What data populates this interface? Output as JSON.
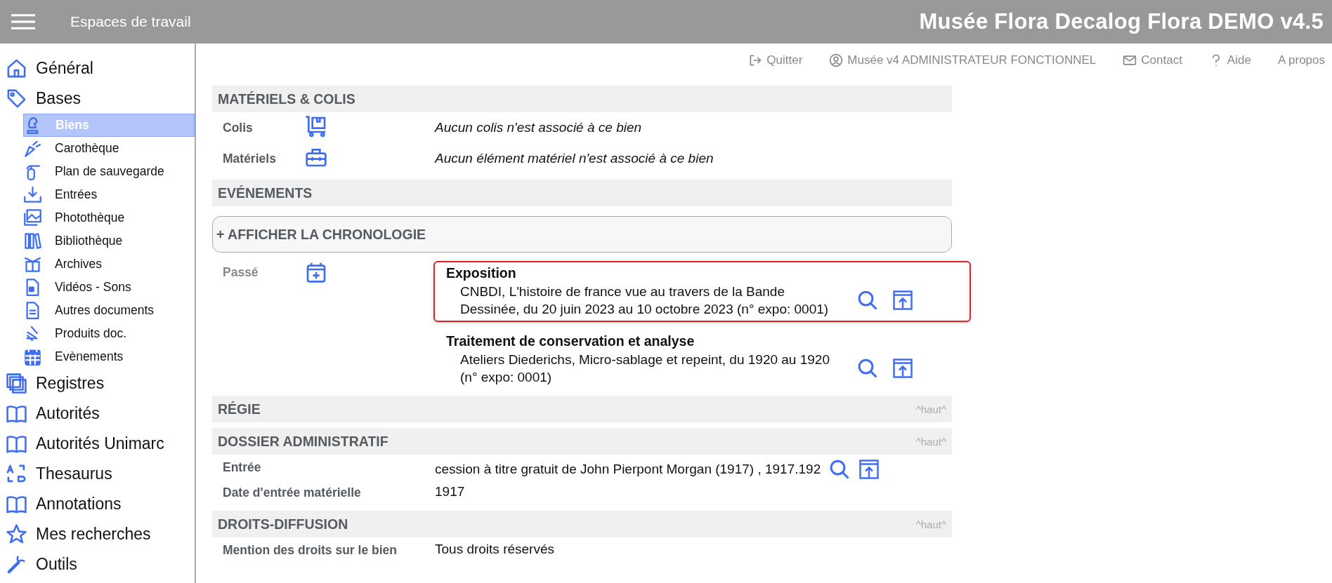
{
  "header": {
    "workspaces": "Espaces de travail",
    "app_title": "Musée Flora Decalog Flora DEMO v4.5"
  },
  "toolbar": [
    {
      "label": "Quitter"
    },
    {
      "label": "Musée v4 ADMINISTRATEUR FONCTIONNEL"
    },
    {
      "label": "Contact"
    },
    {
      "label": "Aide"
    },
    {
      "label": "A propos"
    }
  ],
  "sidebar": {
    "items": [
      {
        "label": "Général"
      },
      {
        "label": "Bases",
        "children": [
          {
            "label": "Biens",
            "selected": true
          },
          {
            "label": "Carothèque",
            "selected": false
          },
          {
            "label": "Plan de sauvegarde",
            "selected": false
          },
          {
            "label": "Entrées",
            "selected": false
          },
          {
            "label": "Photothèque",
            "selected": false
          },
          {
            "label": "Bibliothèque",
            "selected": false
          },
          {
            "label": "Archives",
            "selected": false
          },
          {
            "label": "Vidéos - Sons",
            "selected": false
          },
          {
            "label": "Autres documents",
            "selected": false
          },
          {
            "label": "Produits doc.",
            "selected": false
          },
          {
            "label": "Evènements",
            "selected": false
          }
        ]
      },
      {
        "label": "Registres"
      },
      {
        "label": "Autorités"
      },
      {
        "label": "Autorités Unimarc"
      },
      {
        "label": "Thesaurus"
      },
      {
        "label": "Annotations"
      },
      {
        "label": "Mes recherches"
      },
      {
        "label": "Outils"
      }
    ]
  },
  "sections": [
    {
      "title": "MATÉRIELS & COLIS",
      "rows": [
        {
          "kind": "note",
          "label": "Colis",
          "value": "Aucun colis n'est associé à ce bien"
        },
        {
          "kind": "note",
          "label": "Matériels",
          "value": "Aucun élément matériel n'est associé à ce bien"
        }
      ]
    },
    {
      "title": "EVÉNEMENTS",
      "toggle": "+ AFFICHER LA CHRONOLOGIE",
      "events": {
        "label": "Passé",
        "items": [
          {
            "title": "Exposition",
            "text": "CNBDI, L'histoire de france vue au travers de la Bande Dessinée, du 20 juin 2023 au 10 octobre 2023 (n° expo: 0001)",
            "highlighted": true
          },
          {
            "title": "Traitement de conservation et analyse",
            "text": "Ateliers Diederichs, Micro-sablage et repeint, du 1920 au 1920 (n° expo: 0001)",
            "highlighted": false
          }
        ]
      }
    },
    {
      "title": "RÉGIE",
      "top_link": "^haut^"
    },
    {
      "title": "DOSSIER ADMINISTRATIF",
      "top_link": "^haut^",
      "rows": [
        {
          "kind": "field",
          "label": "Entrée",
          "value": "cession à titre gratuit de John Pierpont Morgan (1917) , 1917.192",
          "actions": true
        },
        {
          "kind": "field",
          "label": "Date d'entrée matérielle",
          "value": "1917",
          "actions": false
        }
      ]
    },
    {
      "title": "DROITS-DIFFUSION",
      "top_link": "^haut^",
      "rows": [
        {
          "kind": "field",
          "label": "Mention des droits sur le bien",
          "value": "Tous droits réservés",
          "actions": false
        }
      ]
    }
  ]
}
